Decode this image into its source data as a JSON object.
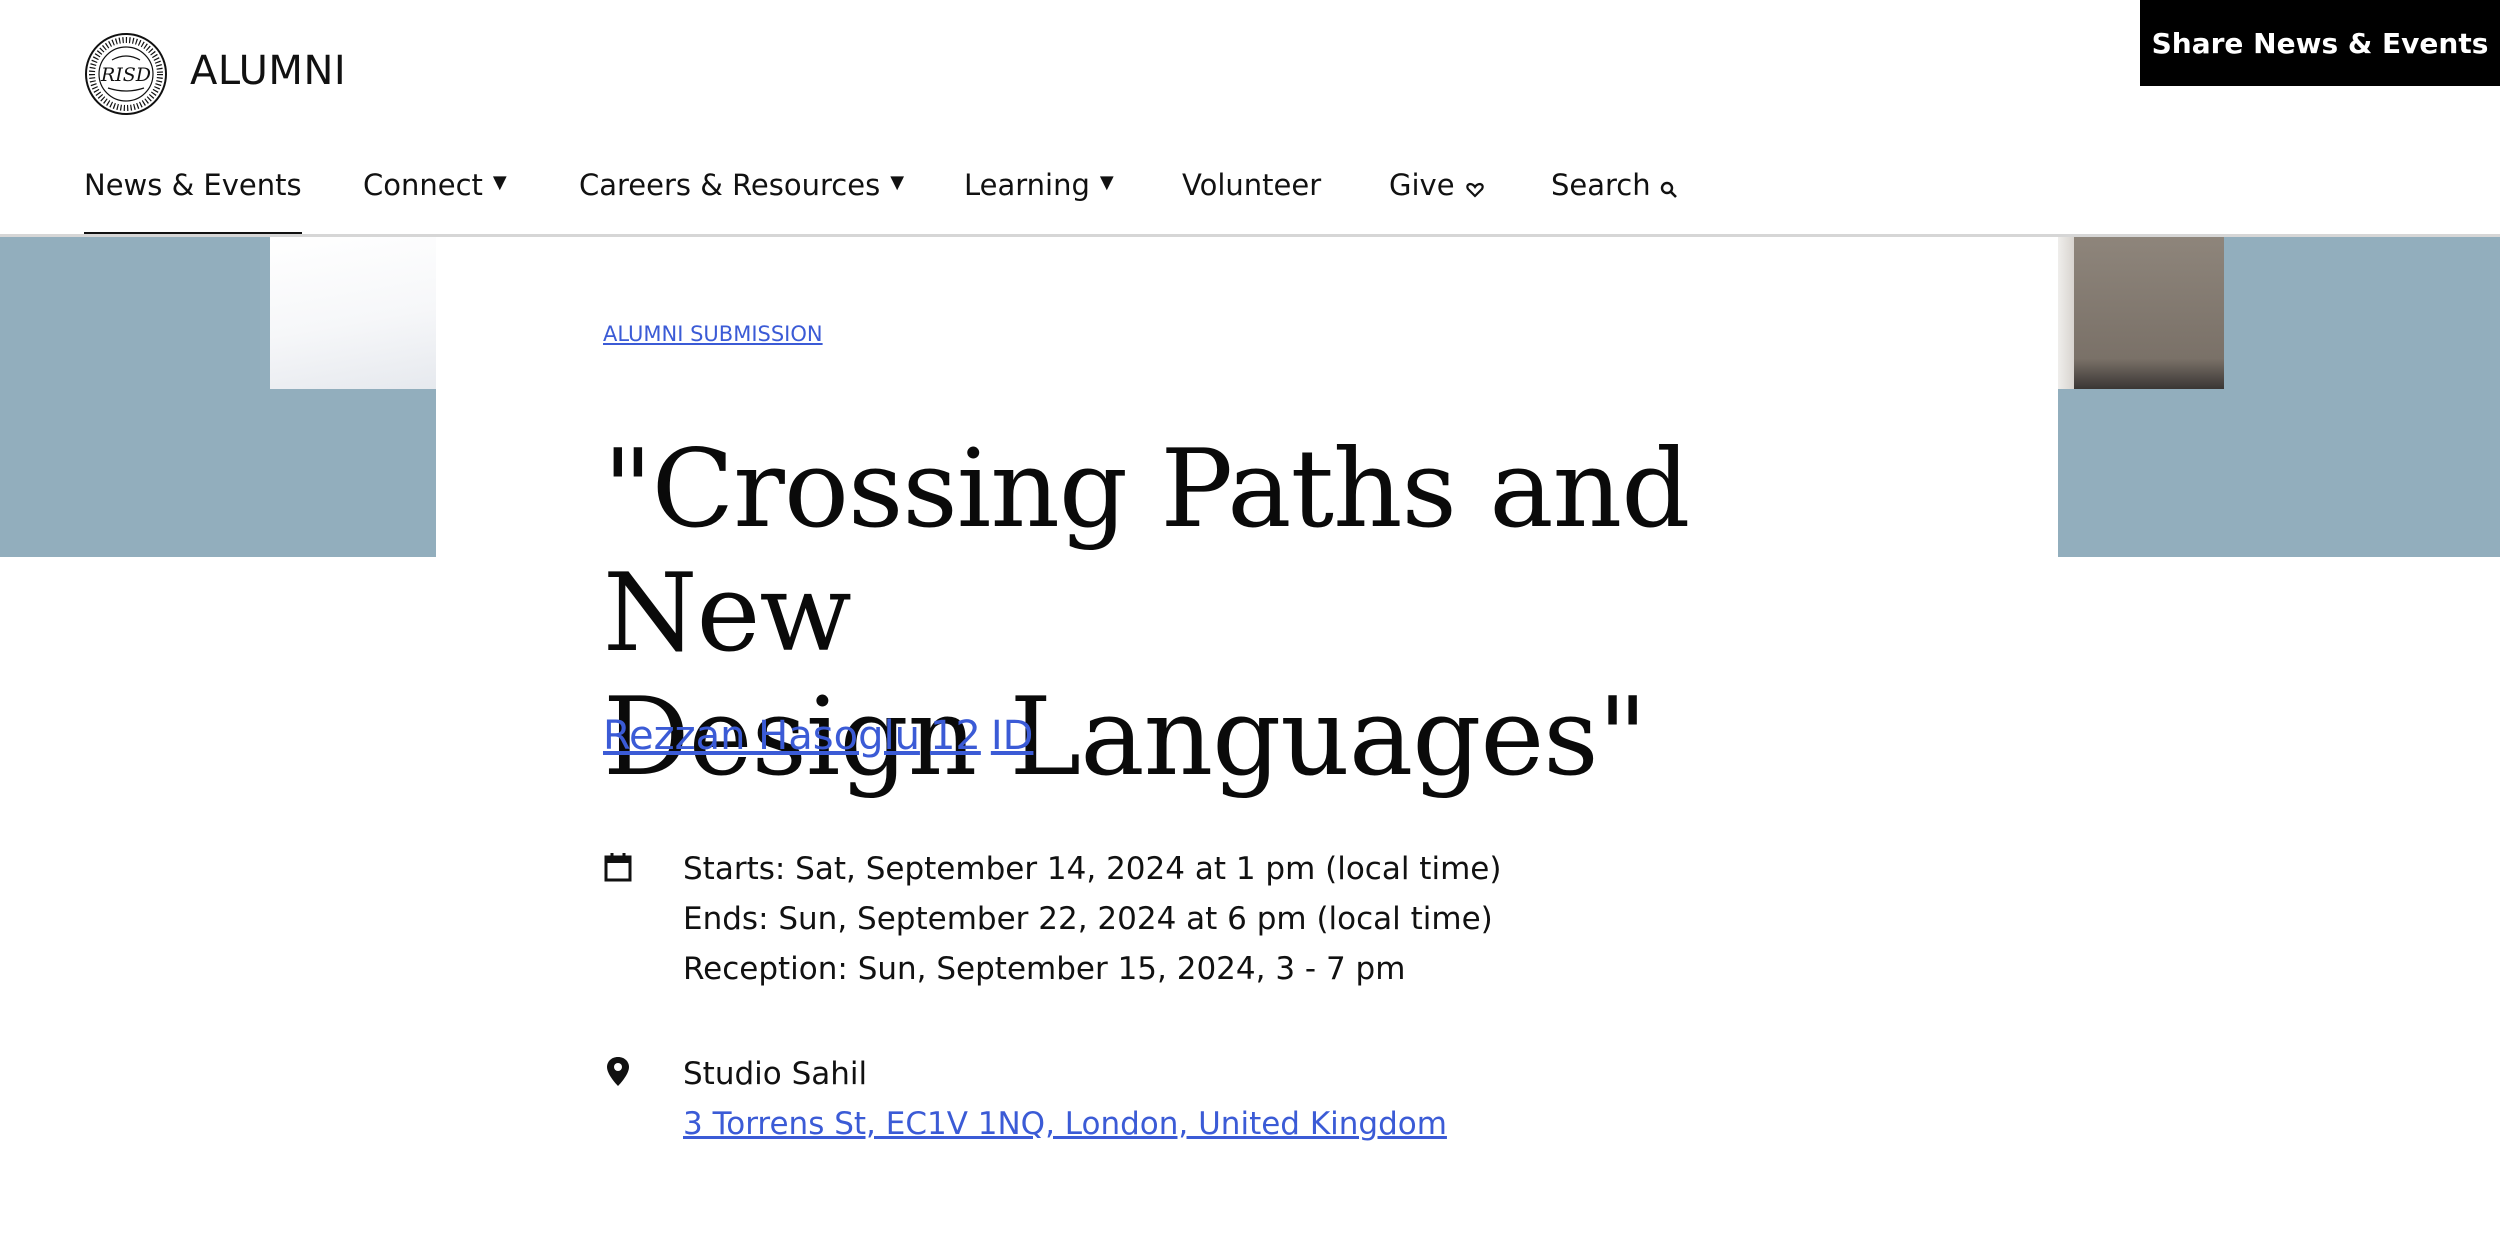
{
  "header": {
    "seal_text": "RISD",
    "seal_ring_text": "RHODE·ISLAND·SCHOOL·OF·DESIGN·1877",
    "wordmark": "ALUMNI",
    "share_button": "Share News & Events"
  },
  "nav": {
    "items": [
      {
        "label": "News & Events",
        "has_caret": false,
        "active": true
      },
      {
        "label": "Connect",
        "has_caret": true
      },
      {
        "label": "Careers & Resources",
        "has_caret": true
      },
      {
        "label": "Learning",
        "has_caret": true
      },
      {
        "label": "Volunteer",
        "has_caret": false
      },
      {
        "label": "Give",
        "has_caret": true
      },
      {
        "label": "Search",
        "has_caret": false
      }
    ]
  },
  "article": {
    "kicker": "ALUMNI SUBMISSION",
    "title_line1": "\"Crossing Paths and New",
    "title_line2": "Design Languages\"",
    "author_name": "Rezzan Hasoglu",
    "author_year": "12",
    "author_major": "ID"
  },
  "schedule": {
    "starts": "Starts: Sat, September 14, 2024 at 1 pm (local time)",
    "ends": "Ends: Sun, September 22, 2024 at 6 pm (local time)",
    "reception": "Reception: Sun, September 15, 2024, 3 - 7 pm"
  },
  "location": {
    "venue": "Studio Sahil",
    "address": "3 Torrens St, EC1V 1NQ, London, United Kingdom"
  },
  "colors": {
    "link": "#3b5bd6",
    "hero_band": "#92aebd",
    "share_bg": "#000000"
  },
  "icons": {
    "calendar": "calendar-icon",
    "location": "location-pin-icon",
    "search": "search-icon",
    "caret": "caret-down-icon",
    "give_caret": "heart-caret-icon"
  }
}
